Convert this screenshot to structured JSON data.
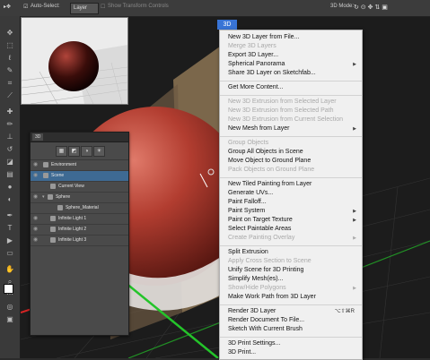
{
  "options_bar": {
    "auto_select_label": "Auto-Select:",
    "auto_select_value": "Layer",
    "transform_label": "Show Transform Controls",
    "mode_label": "3D Mode:"
  },
  "layers_panel": {
    "tab": "3D",
    "rows": [
      {
        "label": "Environment"
      },
      {
        "label": "Scene"
      },
      {
        "label": "Current View"
      },
      {
        "label": "Sphere"
      },
      {
        "label": "Sphere_Material"
      },
      {
        "label": "Infinite Light 1"
      },
      {
        "label": "Infinite Light 2"
      },
      {
        "label": "Infinite Light 3"
      }
    ]
  },
  "menu": {
    "title": "3D",
    "items": [
      {
        "label": "New 3D Layer from File..."
      },
      {
        "label": "Merge 3D Layers"
      },
      {
        "label": "Export 3D Layer..."
      },
      {
        "label": "Spherical Panorama"
      },
      {
        "label": "Share 3D Layer on Sketchfab..."
      },
      {
        "label": "Get More Content..."
      },
      {
        "label": "New 3D Extrusion from Selected Layer"
      },
      {
        "label": "New 3D Extrusion from Selected Path"
      },
      {
        "label": "New 3D Extrusion from Current Selection"
      },
      {
        "label": "New Mesh from Layer"
      },
      {
        "label": "Group Objects"
      },
      {
        "label": "Group All Objects in Scene"
      },
      {
        "label": "Move Object to Ground Plane"
      },
      {
        "label": "Pack Objects on Ground Plane"
      },
      {
        "label": "New Tiled Painting from Layer"
      },
      {
        "label": "Generate UVs..."
      },
      {
        "label": "Paint Falloff..."
      },
      {
        "label": "Paint System"
      },
      {
        "label": "Paint on Target Texture"
      },
      {
        "label": "Select Paintable Areas"
      },
      {
        "label": "Create Painting Overlay"
      },
      {
        "label": "Split Extrusion"
      },
      {
        "label": "Apply Cross Section to Scene"
      },
      {
        "label": "Unify Scene for 3D Printing"
      },
      {
        "label": "Simplify Mesh(es)..."
      },
      {
        "label": "Show/Hide Polygons"
      },
      {
        "label": "Make Work Path from 3D Layer"
      },
      {
        "label": "Render 3D Layer",
        "shortcut": "⌥⇧⌘R"
      },
      {
        "label": "Render Document To File..."
      },
      {
        "label": "Sketch With Current Brush"
      },
      {
        "label": "3D Print Settings..."
      },
      {
        "label": "3D Print..."
      }
    ]
  },
  "colors": {
    "menu_highlight": "#3874d6",
    "sphere": "#a8342a",
    "selection": "#3e6a93"
  }
}
